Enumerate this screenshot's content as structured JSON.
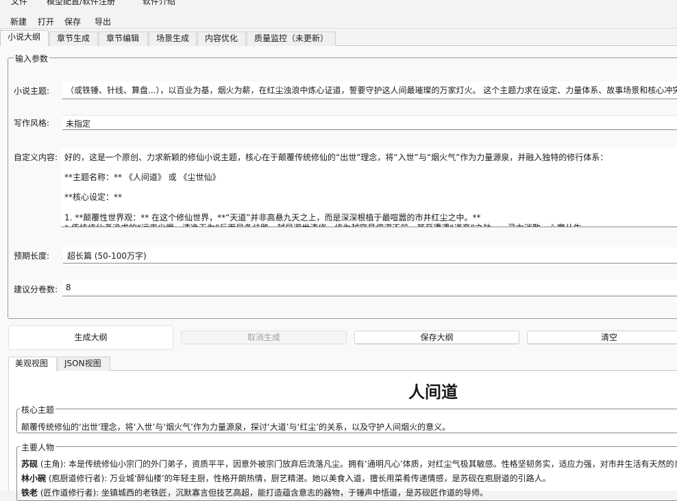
{
  "menu": {
    "file": "文件",
    "model_config": "模型配置/软件注册",
    "about": "软件介绍"
  },
  "toolbar": {
    "new": "新建",
    "open": "打开",
    "save": "保存",
    "export": "导出"
  },
  "tabs": [
    {
      "label": "小说大纲",
      "active": true
    },
    {
      "label": "章节生成"
    },
    {
      "label": "章节编辑"
    },
    {
      "label": "场景生成"
    },
    {
      "label": "内容优化"
    },
    {
      "label": "质量监控（未更新）"
    }
  ],
  "input_params": {
    "legend": "输入参数",
    "theme_label": "小说主题:",
    "theme_value": "（或铁锤、针线、算盘...），以百业为基，烟火为薪，在红尘浊浪中炼心证道，誓要守护这人间最璀璨的万家灯火。 这个主题力求在设定、力量体系、故事场景和核心冲突",
    "style_label": "写作风格:",
    "style_value": "未指定",
    "custom_label": "自定义内容:",
    "custom_lines": [
      "好的，这是一个原创、力求新颖的修仙小说主题，核心在于颠覆传统修仙的“出世”理念，将“入世”与“烟火气”作为力量源泉，并融入独特的修行体系：",
      "**主题名称：** 《人间道》 或 《尘世仙》",
      "**核心设定：**",
      "1.  **颠覆性世界观：** 在这个修仙世界，**“天道”并非高悬九天之上，而是深深根植于最喧嚣的市井红尘之中。**",
      "    *   传统修仙者追求的“远离尘嚣、清净无为”反而是条歧路，越是避世清修，修为越容易停滞不前，甚至遭遇“道衰”之劫——灵力消散，心魔丛生。"
    ],
    "length_label": "预期长度:",
    "length_value": "超长篇 (50-100万字)",
    "volumes_label": "建议分卷数:",
    "volumes_value": "8"
  },
  "actions": {
    "generate": "生成大纲",
    "cancel": "取消生成",
    "save": "保存大纲",
    "clear": "清空"
  },
  "view_tabs": [
    {
      "label": "美观视图",
      "active": true
    },
    {
      "label": "JSON视图"
    }
  ],
  "outline": {
    "title": "人间道",
    "core_theme_legend": "核心主题",
    "core_theme_text": "颠覆传统修仙的‘出世’理念，将‘入世’与‘烟火气’作为力量源泉，探讨‘大道’与‘红尘’的关系，以及守护人间烟火的意义。",
    "characters_legend": "主要人物",
    "characters": [
      {
        "name": "苏砚",
        "desc": " (主角): 本是传统修仙小宗门的外门弟子，资质平平，因意外被宗门放弃后流落凡尘。拥有‘通明凡心’体质，对红尘气极其敏感。性格坚韧务实，适应力强，对市井生活有天然的亲"
      },
      {
        "name": "林小碗",
        "desc": " (庖厨道修行者): 万业城‘醉仙楼’的年轻主厨，性格开朗热情，厨艺精湛。她以美食入道，擅长用菜肴传递情感，是苏砚在庖厨道的引路人。"
      },
      {
        "name": "铁老",
        "desc": " (匠作道修行者): 坐镇城西的老铁匠，沉默寡言但技艺高超，能打造蕴含意志的器物，于锤声中悟道，是苏砚匠作道的导师。"
      }
    ]
  }
}
